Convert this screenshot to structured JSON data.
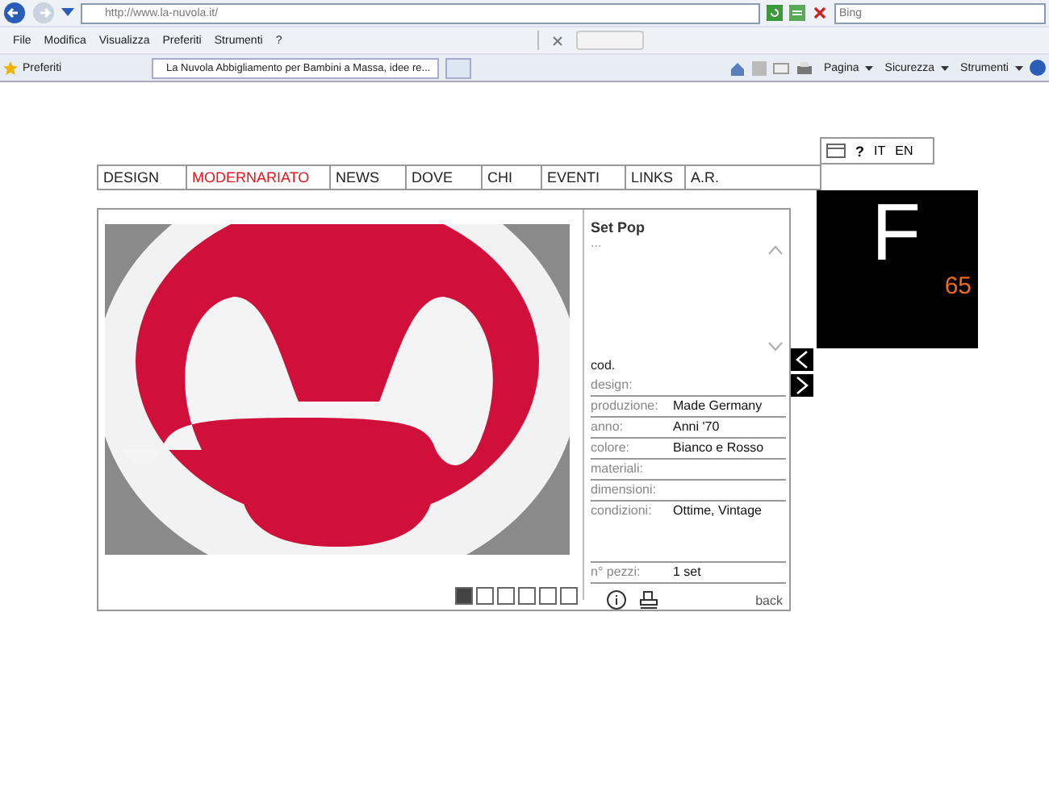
{
  "browser": {
    "address": "http://www.la-nuvola.it/",
    "search_placeholder": "Bing",
    "menu": [
      "File",
      "Modifica",
      "Visualizza",
      "Preferiti",
      "Strumenti",
      "?"
    ],
    "favorites": "Preferiti",
    "tab": "La Nuvola Abbigliamento per Bambini a Massa, idee re...",
    "commands": [
      "Pagina",
      "Sicurezza",
      "Strumenti"
    ]
  },
  "languages": [
    {
      "label": "IT"
    },
    {
      "label": "EN"
    }
  ],
  "help": "?",
  "nav": [
    {
      "label": "DESIGN",
      "selected": false
    },
    {
      "label": "MODERNARIATO",
      "selected": true
    },
    {
      "label": "NEWS",
      "selected": false
    },
    {
      "label": "DOVE",
      "selected": false
    },
    {
      "label": "CHI",
      "selected": false
    },
    {
      "label": "EVENTI",
      "selected": false
    },
    {
      "label": "LINKS",
      "selected": false
    },
    {
      "label": "A.R.",
      "selected": false
    }
  ],
  "logo": {
    "letter": "F",
    "number": "65"
  },
  "product": {
    "title": "Set Pop",
    "description": "...",
    "code_label": "cod.",
    "details": [
      {
        "label": "design:"
      },
      {
        "label": "produzione:",
        "value": "Made Germany"
      },
      {
        "label": "anno:",
        "value": "Anni '70"
      },
      {
        "label": "colore:",
        "value": "Bianco e Rosso"
      },
      {
        "label": "materiali:"
      },
      {
        "label": "dimensioni:"
      },
      {
        "label": "condizioni:",
        "value": "Ottime, Vintage",
        "kind": "tall"
      },
      {
        "label": "n° pezzi:",
        "value": "1 set"
      }
    ],
    "back": "back"
  },
  "thumbnails": [
    {
      "selected": true
    },
    {
      "selected": false
    },
    {
      "selected": false
    },
    {
      "selected": false
    },
    {
      "selected": false
    },
    {
      "selected": false
    }
  ]
}
